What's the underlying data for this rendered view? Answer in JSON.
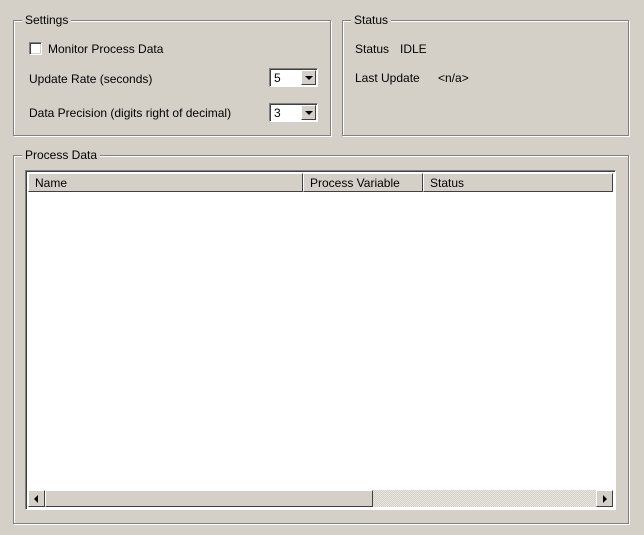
{
  "settings": {
    "legend": "Settings",
    "monitor_label": "Monitor Process Data",
    "monitor_checked": false,
    "update_rate_label": "Update Rate (seconds)",
    "update_rate_value": "5",
    "precision_label": "Data Precision (digits right of decimal)",
    "precision_value": "3"
  },
  "status": {
    "legend": "Status",
    "status_label": "Status",
    "status_value": "IDLE",
    "last_update_label": "Last Update",
    "last_update_value": "<n/a>"
  },
  "process_data": {
    "legend": "Process Data",
    "columns": [
      "Name",
      "Process Variable",
      "Status"
    ],
    "rows": []
  }
}
